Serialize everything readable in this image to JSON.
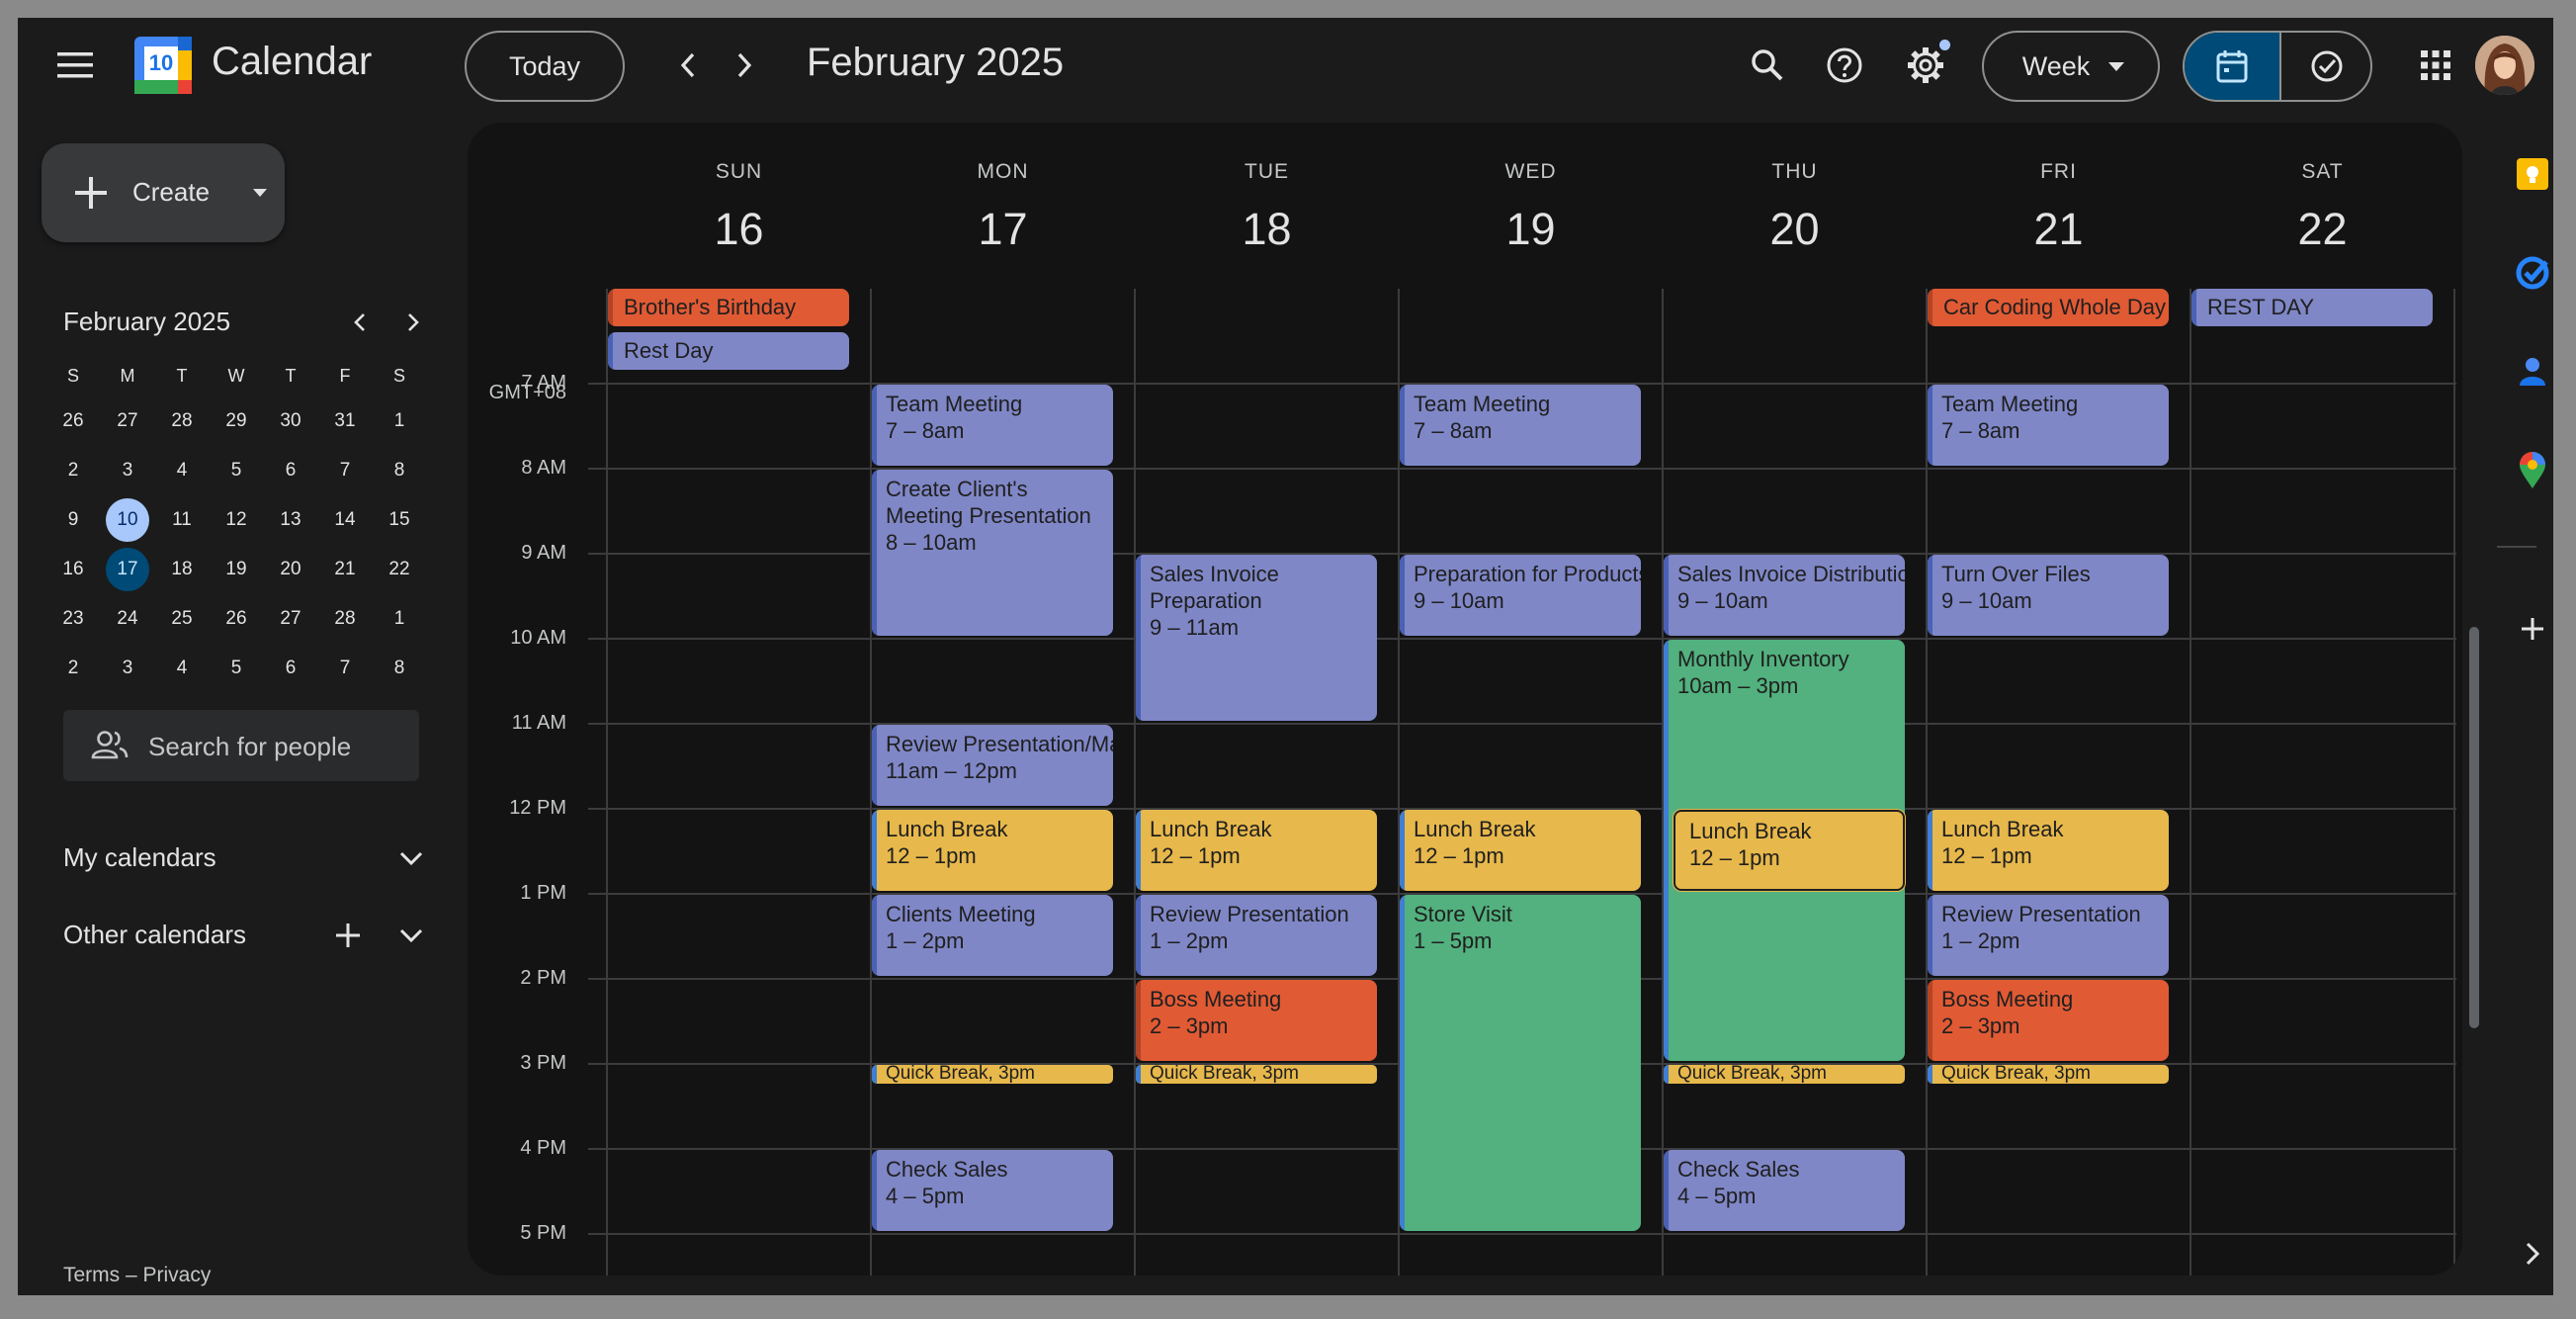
{
  "header": {
    "app_title": "Calendar",
    "logo_day": "10",
    "today_label": "Today",
    "month_title": "February 2025",
    "view_label": "Week"
  },
  "sidebar": {
    "create_label": "Create",
    "mini_month": "February 2025",
    "weekday_initials": [
      "S",
      "M",
      "T",
      "W",
      "T",
      "F",
      "S"
    ],
    "weeks": [
      [
        "26",
        "27",
        "28",
        "29",
        "30",
        "31",
        "1"
      ],
      [
        "2",
        "3",
        "4",
        "5",
        "6",
        "7",
        "8"
      ],
      [
        "9",
        "10",
        "11",
        "12",
        "13",
        "14",
        "15"
      ],
      [
        "16",
        "17",
        "18",
        "19",
        "20",
        "21",
        "22"
      ],
      [
        "23",
        "24",
        "25",
        "26",
        "27",
        "28",
        "1"
      ],
      [
        "2",
        "3",
        "4",
        "5",
        "6",
        "7",
        "8"
      ]
    ],
    "today_date": "10",
    "selected_date": "17",
    "search_people_placeholder": "Search for people",
    "my_calendars": "My calendars",
    "other_calendars": "Other calendars",
    "footer": "Terms – Privacy"
  },
  "grid": {
    "timezone": "GMT+08",
    "days": [
      {
        "name": "SUN",
        "num": "16"
      },
      {
        "name": "MON",
        "num": "17"
      },
      {
        "name": "TUE",
        "num": "18"
      },
      {
        "name": "WED",
        "num": "19"
      },
      {
        "name": "THU",
        "num": "20"
      },
      {
        "name": "FRI",
        "num": "21"
      },
      {
        "name": "SAT",
        "num": "22"
      }
    ],
    "hours": [
      "7 AM",
      "8 AM",
      "9 AM",
      "10 AM",
      "11 AM",
      "12 PM",
      "1 PM",
      "2 PM",
      "3 PM",
      "4 PM",
      "5 PM"
    ]
  },
  "allday_events": [
    {
      "day": 0,
      "row": 0,
      "title": "Brother's Birthday",
      "color": "orange"
    },
    {
      "day": 0,
      "row": 1,
      "title": "Rest Day",
      "color": "blue"
    },
    {
      "day": 5,
      "row": 0,
      "title": "Car Coding Whole Day",
      "color": "orange"
    },
    {
      "day": 6,
      "row": 0,
      "title": "REST DAY",
      "color": "blue"
    }
  ],
  "events": [
    {
      "day": 1,
      "start": 7,
      "end": 8,
      "title": "Team Meeting",
      "time": "7 – 8am",
      "color": "blue"
    },
    {
      "day": 1,
      "start": 8,
      "end": 10,
      "title": "Create Client's Meeting Presentation",
      "time": "8 – 10am",
      "color": "blue"
    },
    {
      "day": 1,
      "start": 11,
      "end": 12,
      "title": "Review Presentation/Materials",
      "time": "11am – 12pm",
      "color": "blue",
      "nowrap": true
    },
    {
      "day": 1,
      "start": 12,
      "end": 13,
      "title": "Lunch Break",
      "time": "12 – 1pm",
      "color": "yellow"
    },
    {
      "day": 1,
      "start": 13,
      "end": 14,
      "title": "Clients Meeting",
      "time": "1 – 2pm",
      "color": "blue"
    },
    {
      "day": 1,
      "start": 16,
      "end": 17,
      "title": "Check Sales",
      "time": "4 – 5pm",
      "color": "blue"
    },
    {
      "day": 2,
      "start": 9,
      "end": 11,
      "title": "Sales Invoice Preparation",
      "time": "9 – 11am",
      "color": "blue"
    },
    {
      "day": 2,
      "start": 12,
      "end": 13,
      "title": "Lunch Break",
      "time": "12 – 1pm",
      "color": "yellow"
    },
    {
      "day": 2,
      "start": 13,
      "end": 14,
      "title": "Review Presentation",
      "time": "1 – 2pm",
      "color": "blue"
    },
    {
      "day": 2,
      "start": 14,
      "end": 15,
      "title": "Boss Meeting",
      "time": "2 – 3pm",
      "color": "orange"
    },
    {
      "day": 3,
      "start": 7,
      "end": 8,
      "title": "Team Meeting",
      "time": "7 – 8am",
      "color": "blue"
    },
    {
      "day": 3,
      "start": 9,
      "end": 10,
      "title": "Preparation for Products",
      "time": "9 – 10am",
      "color": "blue",
      "nowrap": true
    },
    {
      "day": 3,
      "start": 12,
      "end": 13,
      "title": "Lunch Break",
      "time": "12 – 1pm",
      "color": "yellow"
    },
    {
      "day": 3,
      "start": 13,
      "end": 17,
      "title": "Store Visit",
      "time": "1 – 5pm",
      "color": "green"
    },
    {
      "day": 4,
      "start": 9,
      "end": 10,
      "title": "Sales Invoice Distribution",
      "time": "9 – 10am",
      "color": "blue",
      "nowrap": true
    },
    {
      "day": 4,
      "start": 10,
      "end": 15,
      "title": "Monthly Inventory",
      "time": "10am – 3pm",
      "color": "green"
    },
    {
      "day": 4,
      "start": 12,
      "end": 13,
      "title": "Lunch Break",
      "time": "12 – 1pm",
      "color": "yellow",
      "overlap": true
    },
    {
      "day": 4,
      "start": 16,
      "end": 17,
      "title": "Check Sales",
      "time": "4 – 5pm",
      "color": "blue"
    },
    {
      "day": 5,
      "start": 7,
      "end": 8,
      "title": "Team Meeting",
      "time": "7 – 8am",
      "color": "blue"
    },
    {
      "day": 5,
      "start": 9,
      "end": 10,
      "title": "Turn Over Files",
      "time": "9 – 10am",
      "color": "blue"
    },
    {
      "day": 5,
      "start": 12,
      "end": 13,
      "title": "Lunch Break",
      "time": "12 – 1pm",
      "color": "yellow"
    },
    {
      "day": 5,
      "start": 13,
      "end": 14,
      "title": "Review Presentation",
      "time": "1 – 2pm",
      "color": "blue"
    },
    {
      "day": 5,
      "start": 14,
      "end": 15,
      "title": "Boss Meeting",
      "time": "2 – 3pm",
      "color": "orange"
    }
  ],
  "quick_breaks": [
    {
      "day": 1,
      "title": "Quick Break",
      "time": ", 3pm"
    },
    {
      "day": 2,
      "title": "Quick Break",
      "time": ", 3pm"
    },
    {
      "day": 4,
      "title": "Quick Break",
      "time": ", 3pm"
    },
    {
      "day": 5,
      "title": "Quick Break",
      "time": ", 3pm"
    }
  ],
  "colors": {
    "blue": "#7f87c7",
    "orange": "#e05a34",
    "yellow": "#e7b84b",
    "green": "#52b17e",
    "selected_view": "#004a77"
  }
}
